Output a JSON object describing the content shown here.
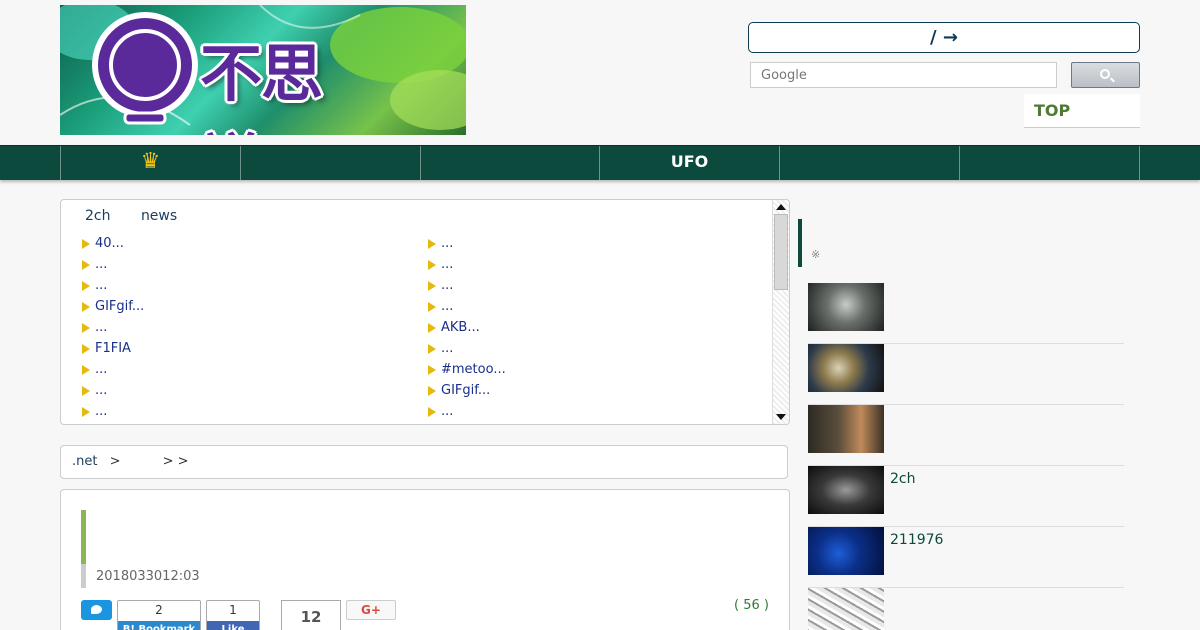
{
  "header": {
    "logo_text": "不思議.NET",
    "random_button": "/ →",
    "search": {
      "placeholder": "Google"
    },
    "top_link": "TOP"
  },
  "nav": {
    "items": [
      {
        "label": "",
        "icon": "crown-icon"
      },
      {
        "label": ""
      },
      {
        "label": ""
      },
      {
        "label": "UFO"
      },
      {
        "label": ""
      },
      {
        "label": ""
      }
    ]
  },
  "ranking": {
    "tabs": [
      "2ch",
      "news"
    ],
    "left": [
      "40...",
      "...",
      "...",
      "GIFgif...",
      "...",
      "F1FIA",
      "...",
      "...",
      "..."
    ],
    "right": [
      "...",
      "...",
      "...",
      "...",
      "AKB...",
      "...",
      "#metoo...",
      "GIFgif...",
      "..."
    ]
  },
  "breadcrumb": {
    "home": ".net",
    "sep1": ">",
    "sep2": "> >"
  },
  "article": {
    "date": "2018033012:03",
    "hatena_count": "2",
    "hatena_label": "B! Bookmark",
    "fb_count": "1",
    "fb_label": "Like",
    "share_count": "12",
    "gplus_label": "G+",
    "comments": "( 56 )"
  },
  "sidebar": {
    "note": "※",
    "items": [
      {
        "label": ""
      },
      {
        "label": ""
      },
      {
        "label": ""
      },
      {
        "label": "2ch"
      },
      {
        "label": "211976"
      },
      {
        "label": ""
      }
    ]
  },
  "colors": {
    "nav_bg": "#0b4a3c",
    "accent_green": "#8bb752",
    "link_blue": "#1a2f8a",
    "top_green": "#4e7a31"
  }
}
